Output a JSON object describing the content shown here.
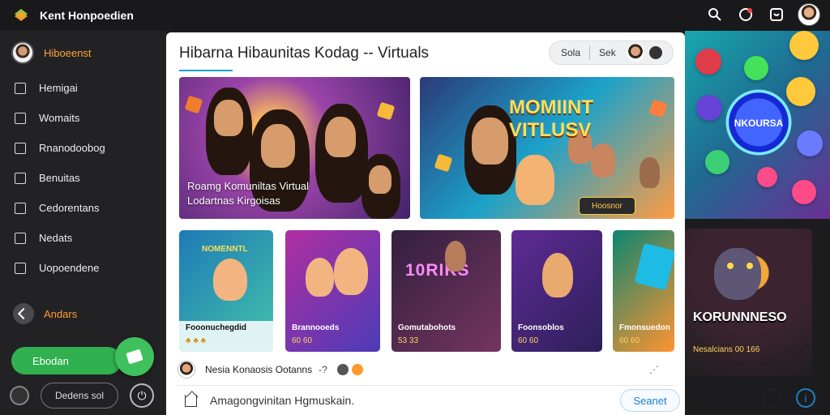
{
  "app": {
    "title": "Kent Honpoedien"
  },
  "sidebar": {
    "profile": "Hiboeenst",
    "items": [
      {
        "label": "Hemigai",
        "icon": "square-icon"
      },
      {
        "label": "Womaits",
        "icon": "envelope-icon"
      },
      {
        "label": "Rnanodoobog",
        "icon": "archive-icon"
      },
      {
        "label": "Benuitas",
        "icon": "checkbox-icon"
      },
      {
        "label": "Cedorentans",
        "icon": "check-list-icon"
      },
      {
        "label": "Nedats",
        "icon": "shield-icon"
      },
      {
        "label": "Uopoendene",
        "icon": "send-icon"
      }
    ],
    "section_label": "Andars",
    "green_button": "Ebodan",
    "bottom_pill": "Dedens\nsol"
  },
  "main": {
    "title": "Hibarna Hibaunitas Kodag -- Virtuals",
    "header_buttons": [
      "Sola",
      "Sek"
    ],
    "hero_left": {
      "line1": "Roamg Komuniltas Virtual",
      "line2": "Lodartnas Kirgoisas"
    },
    "hero_right": {
      "title": "MOMIINT VITLUSV",
      "badge": "Hoosnor"
    },
    "cards": [
      {
        "title": "NOMENNTL",
        "label": "Fooonuchegdid",
        "sub": "♣ ♣ ♣"
      },
      {
        "title": "",
        "label": "Brannooeds",
        "sub": "60 60"
      },
      {
        "title": "10RIKS",
        "label": "Gomutabohots",
        "sub": "53 33"
      },
      {
        "title": "",
        "label": "Foonsoblos",
        "sub": "60 60"
      },
      {
        "title": "",
        "label": "Fmonsuedon",
        "sub": "60 60"
      }
    ],
    "right_card": {
      "title": "KORUNNNESO",
      "sub": "Nesalcians\n00 166"
    },
    "feed": {
      "text": "Nesia Konaosis Ootanns",
      "counter": "-?",
      "more": "⋰"
    },
    "compose": {
      "text": "Amagongvinitan Hgmuskain.",
      "send": "Seanet"
    }
  },
  "right_panel": {
    "orb_label": "NKOURSA"
  },
  "colors": {
    "sidebar_accent": "#ffa23a",
    "green": "#30b04e",
    "link": "#1d80c7"
  }
}
